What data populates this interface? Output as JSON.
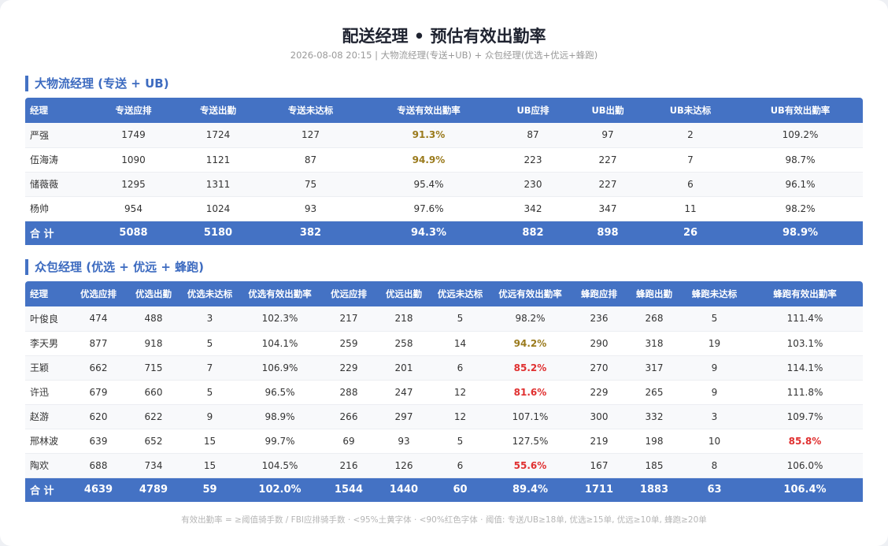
{
  "title": "配送经理 • 预估有效出勤率",
  "subtitle": "2026-08-08 20:15 | 大物流经理(专送+UB) + 众包经理(优选+优远+蜂跑)",
  "colors": {
    "accent": "#4472c4",
    "warn": "#9a7a1c",
    "bad": "#e03030"
  },
  "section1": {
    "title": "大物流经理 (专送 + UB)",
    "headers": [
      "经理",
      "专送应排",
      "专送出勤",
      "专送未达标",
      "专送有效出勤率",
      "UB应排",
      "UB出勤",
      "UB未达标",
      "UB有效出勤率"
    ],
    "rows": [
      {
        "cells": [
          "严强",
          "1749",
          "1724",
          "127",
          "91.3%",
          "87",
          "97",
          "2",
          "109.2%"
        ],
        "flags": {
          "4": "warn"
        }
      },
      {
        "cells": [
          "伍海涛",
          "1090",
          "1121",
          "87",
          "94.9%",
          "223",
          "227",
          "7",
          "98.7%"
        ],
        "flags": {
          "4": "warn"
        }
      },
      {
        "cells": [
          "储薇薇",
          "1295",
          "1311",
          "75",
          "95.4%",
          "230",
          "227",
          "6",
          "96.1%"
        ],
        "flags": {}
      },
      {
        "cells": [
          "杨帅",
          "954",
          "1024",
          "93",
          "97.6%",
          "342",
          "347",
          "11",
          "98.2%"
        ],
        "flags": {}
      }
    ],
    "total": [
      "合 计",
      "5088",
      "5180",
      "382",
      "94.3%",
      "882",
      "898",
      "26",
      "98.9%"
    ]
  },
  "section2": {
    "title": "众包经理 (优选 + 优远 + 蜂跑)",
    "headers": [
      "经理",
      "优选应排",
      "优选出勤",
      "优选未达标",
      "优选有效出勤率",
      "优远应排",
      "优远出勤",
      "优远未达标",
      "优远有效出勤率",
      "蜂跑应排",
      "蜂跑出勤",
      "蜂跑未达标",
      "蜂跑有效出勤率"
    ],
    "rows": [
      {
        "cells": [
          "叶俊良",
          "474",
          "488",
          "3",
          "102.3%",
          "217",
          "218",
          "5",
          "98.2%",
          "236",
          "268",
          "5",
          "111.4%"
        ],
        "flags": {}
      },
      {
        "cells": [
          "李天男",
          "877",
          "918",
          "5",
          "104.1%",
          "259",
          "258",
          "14",
          "94.2%",
          "290",
          "318",
          "19",
          "103.1%"
        ],
        "flags": {
          "8": "warn"
        }
      },
      {
        "cells": [
          "王颖",
          "662",
          "715",
          "7",
          "106.9%",
          "229",
          "201",
          "6",
          "85.2%",
          "270",
          "317",
          "9",
          "114.1%"
        ],
        "flags": {
          "8": "bad"
        }
      },
      {
        "cells": [
          "许迅",
          "679",
          "660",
          "5",
          "96.5%",
          "288",
          "247",
          "12",
          "81.6%",
          "229",
          "265",
          "9",
          "111.8%"
        ],
        "flags": {
          "8": "bad"
        }
      },
      {
        "cells": [
          "赵游",
          "620",
          "622",
          "9",
          "98.9%",
          "266",
          "297",
          "12",
          "107.1%",
          "300",
          "332",
          "3",
          "109.7%"
        ],
        "flags": {}
      },
      {
        "cells": [
          "邢林波",
          "639",
          "652",
          "15",
          "99.7%",
          "69",
          "93",
          "5",
          "127.5%",
          "219",
          "198",
          "10",
          "85.8%"
        ],
        "flags": {
          "12": "bad"
        }
      },
      {
        "cells": [
          "陶欢",
          "688",
          "734",
          "15",
          "104.5%",
          "216",
          "126",
          "6",
          "55.6%",
          "167",
          "185",
          "8",
          "106.0%"
        ],
        "flags": {
          "8": "bad"
        }
      }
    ],
    "total": [
      "合 计",
      "4639",
      "4789",
      "59",
      "102.0%",
      "1544",
      "1440",
      "60",
      "89.4%",
      "1711",
      "1883",
      "63",
      "106.4%"
    ]
  },
  "footer": "有效出勤率 = ≥阈值骑手数 / FBI应排骑手数 · <95%土黄字体 · <90%红色字体 · 阈值: 专送/UB≥18单, 优选≥15单, 优远≥10单, 蜂跑≥20单"
}
